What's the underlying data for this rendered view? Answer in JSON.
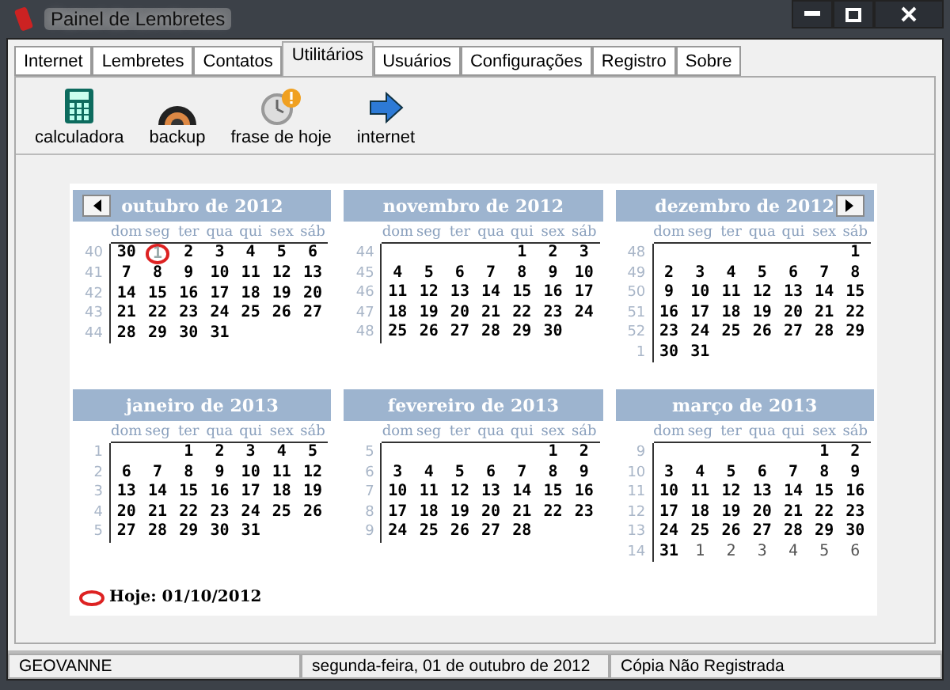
{
  "window": {
    "title": "Painel de Lembretes"
  },
  "tabs": [
    {
      "label": "Internet",
      "selected": false
    },
    {
      "label": "Lembretes",
      "selected": false
    },
    {
      "label": "Contatos",
      "selected": false
    },
    {
      "label": "Utilitários",
      "selected": true
    },
    {
      "label": "Usuários",
      "selected": false
    },
    {
      "label": "Configurações",
      "selected": false
    },
    {
      "label": "Registro",
      "selected": false
    },
    {
      "label": "Sobre",
      "selected": false
    }
  ],
  "tools": [
    {
      "label": "calculadora",
      "kind": "calculator"
    },
    {
      "label": "backup",
      "kind": "backup"
    },
    {
      "label": "frase de hoje",
      "kind": "clock"
    },
    {
      "label": "internet",
      "kind": "arrow"
    }
  ],
  "calendar": {
    "months": [
      {
        "title": "outubro de 2012",
        "prev_button": true,
        "weekdays": [
          "dom",
          "seg",
          "ter",
          "qua",
          "qui",
          "sex",
          "sáb"
        ],
        "weeks": [
          {
            "week": "40",
            "days": [
              "30",
              {
                "text": "1",
                "kind": "today"
              },
              "2",
              "3",
              "4",
              "5",
              "6"
            ]
          },
          {
            "week": "41",
            "days": [
              "7",
              "8",
              "9",
              "10",
              "11",
              "12",
              "13"
            ]
          },
          {
            "week": "42",
            "days": [
              "14",
              "15",
              "16",
              "17",
              "18",
              "19",
              "20"
            ]
          },
          {
            "week": "43",
            "days": [
              "21",
              "22",
              "23",
              "24",
              "25",
              "26",
              "27"
            ]
          },
          {
            "week": "44",
            "kind": "last",
            "days": [
              "28",
              "29",
              "30",
              "31"
            ]
          }
        ]
      },
      {
        "title": "novembro de 2012",
        "weekdays": [
          "dom",
          "seg",
          "ter",
          "qua",
          "qui",
          "sex",
          "sáb"
        ],
        "weeks": [
          {
            "week": "44",
            "kind": "first",
            "days": [
              "1",
              "2",
              "3"
            ]
          },
          {
            "week": "45",
            "days": [
              "4",
              "5",
              "6",
              "7",
              "8",
              "9",
              "10"
            ]
          },
          {
            "week": "46",
            "days": [
              "11",
              "12",
              "13",
              "14",
              "15",
              "16",
              "17"
            ]
          },
          {
            "week": "47",
            "days": [
              "18",
              "19",
              "20",
              "21",
              "22",
              "23",
              "24"
            ]
          },
          {
            "week": "48",
            "kind": "last",
            "days": [
              "25",
              "26",
              "27",
              "28",
              "29",
              "30"
            ]
          }
        ]
      },
      {
        "title": "dezembro de 2012",
        "next_button": true,
        "weekdays": [
          "dom",
          "seg",
          "ter",
          "qua",
          "qui",
          "sex",
          "sáb"
        ],
        "weeks": [
          {
            "week": "48",
            "kind": "first",
            "days": [
              "1"
            ]
          },
          {
            "week": "49",
            "days": [
              "2",
              "3",
              "4",
              "5",
              "6",
              "7",
              "8"
            ]
          },
          {
            "week": "50",
            "days": [
              "9",
              "10",
              "11",
              "12",
              "13",
              "14",
              "15"
            ]
          },
          {
            "week": "51",
            "days": [
              "16",
              "17",
              "18",
              "19",
              "20",
              "21",
              "22"
            ]
          },
          {
            "week": "52",
            "days": [
              "23",
              "24",
              "25",
              "26",
              "27",
              "28",
              "29"
            ]
          },
          {
            "week": "1",
            "kind": "last",
            "days": [
              "30",
              "31"
            ]
          }
        ]
      },
      {
        "title": "janeiro de 2013",
        "weekdays": [
          "dom",
          "seg",
          "ter",
          "qua",
          "qui",
          "sex",
          "sáb"
        ],
        "weeks": [
          {
            "week": "1",
            "kind": "first",
            "days": [
              "1",
              "2",
              "3",
              "4",
              "5"
            ]
          },
          {
            "week": "2",
            "days": [
              "6",
              "7",
              "8",
              "9",
              "10",
              "11",
              "12"
            ]
          },
          {
            "week": "3",
            "days": [
              "13",
              "14",
              "15",
              "16",
              "17",
              "18",
              "19"
            ]
          },
          {
            "week": "4",
            "days": [
              "20",
              "21",
              "22",
              "23",
              "24",
              "25",
              "26"
            ]
          },
          {
            "week": "5",
            "kind": "last",
            "days": [
              "27",
              "28",
              "29",
              "30",
              "31"
            ]
          }
        ]
      },
      {
        "title": "fevereiro de 2013",
        "weekdays": [
          "dom",
          "seg",
          "ter",
          "qua",
          "qui",
          "sex",
          "sáb"
        ],
        "weeks": [
          {
            "week": "5",
            "kind": "first",
            "days": [
              "1",
              "2"
            ]
          },
          {
            "week": "6",
            "days": [
              "3",
              "4",
              "5",
              "6",
              "7",
              "8",
              "9"
            ]
          },
          {
            "week": "7",
            "days": [
              "10",
              "11",
              "12",
              "13",
              "14",
              "15",
              "16"
            ]
          },
          {
            "week": "8",
            "days": [
              "17",
              "18",
              "19",
              "20",
              "21",
              "22",
              "23"
            ]
          },
          {
            "week": "9",
            "kind": "last",
            "days": [
              "24",
              "25",
              "26",
              "27",
              "28"
            ]
          }
        ]
      },
      {
        "title": "março de 2013",
        "weekdays": [
          "dom",
          "seg",
          "ter",
          "qua",
          "qui",
          "sex",
          "sáb"
        ],
        "weeks": [
          {
            "week": "9",
            "kind": "first",
            "days": [
              "1",
              "2"
            ]
          },
          {
            "week": "10",
            "days": [
              "3",
              "4",
              "5",
              "6",
              "7",
              "8",
              "9"
            ]
          },
          {
            "week": "11",
            "days": [
              "10",
              "11",
              "12",
              "13",
              "14",
              "15",
              "16"
            ]
          },
          {
            "week": "12",
            "days": [
              "17",
              "18",
              "19",
              "20",
              "21",
              "22",
              "23"
            ]
          },
          {
            "week": "13",
            "days": [
              "24",
              "25",
              "26",
              "27",
              "28",
              "29",
              "30"
            ]
          },
          {
            "week": "14",
            "days": [
              "31",
              {
                "text": "1",
                "kind": "muted"
              },
              {
                "text": "2",
                "kind": "muted"
              },
              {
                "text": "3",
                "kind": "muted"
              },
              {
                "text": "4",
                "kind": "muted"
              },
              {
                "text": "5",
                "kind": "muted"
              },
              {
                "text": "6",
                "kind": "muted"
              }
            ]
          }
        ]
      }
    ],
    "today_label": "Hoje: 01/10/2012"
  },
  "status_bar": [
    "GEOVANNE",
    "segunda-feira, 01 de outubro de 2012",
    "Cópia Não Registrada"
  ]
}
